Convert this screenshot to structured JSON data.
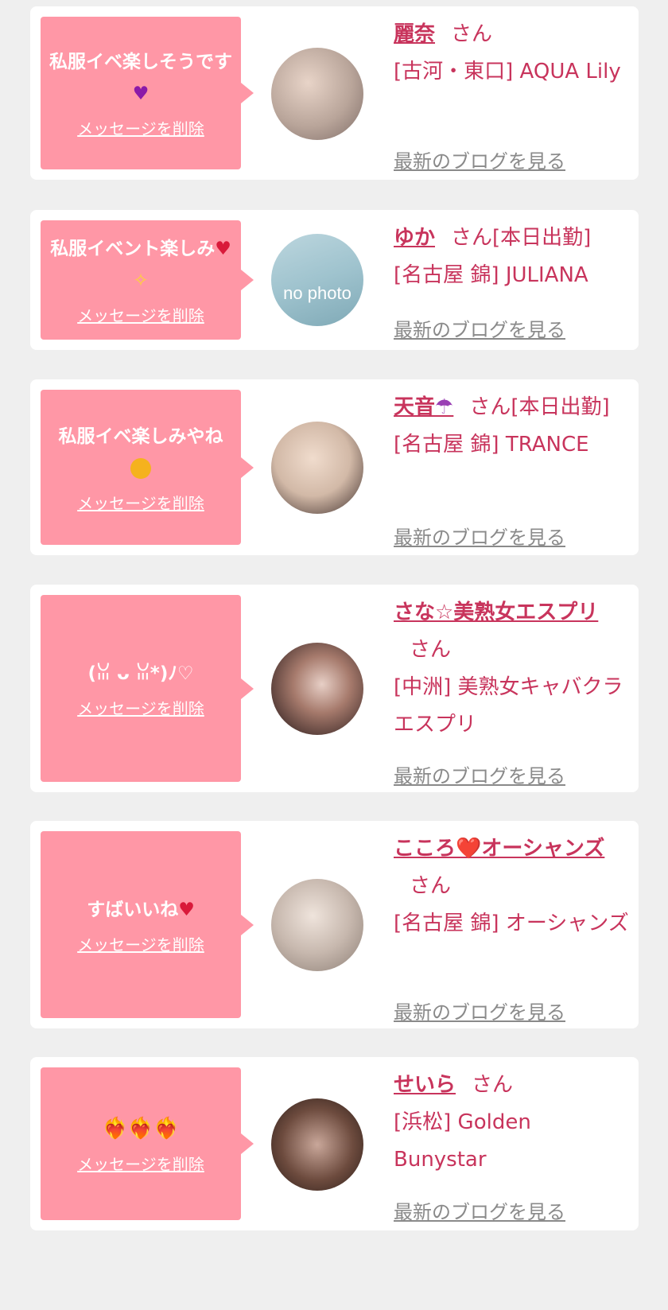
{
  "cards": [
    {
      "message": "私服イベ楽しそうです",
      "message_emoji": "purple-heart",
      "delete_label": "メッセージを削除",
      "name": "麗奈",
      "san": "さん",
      "status": "",
      "shop": "[古河・東口] AQUA Lily",
      "blog_label": "最新のブログを見る",
      "avatar_color": "#b9a59a"
    },
    {
      "message": "私服イベント楽しみ",
      "message_emoji": "heart-sparkle",
      "delete_label": "メッセージを削除",
      "name": "ゆか",
      "san": "さん",
      "status": "[本日出勤]",
      "shop": "[名古屋 錦] JULIANA",
      "blog_label": "最新のブログを見る",
      "avatar_label": "no photo",
      "avatar_color": "#9fc3ce"
    },
    {
      "message": "私服イベ楽しみやね",
      "message_emoji": "smile",
      "delete_label": "メッセージを削除",
      "name": "天音",
      "name_emoji": "jellyfish",
      "san": "さん",
      "status": "[本日出勤]",
      "shop": "[名古屋 錦] TRANCE",
      "blog_label": "最新のブログを見る",
      "avatar_color": "#d2b9a7"
    },
    {
      "message": "(ꈍ ᴗ ꈍ*)ﾉ♡",
      "message_emoji": "",
      "delete_label": "メッセージを削除",
      "name": "さな☆美熟女エスプリ",
      "san": "さん",
      "status": "",
      "shop": "[中洲] 美熟女キャバクラ エスプリ",
      "blog_label": "最新のブログを見る",
      "avatar_color": "#5a3a35"
    },
    {
      "message": "すばいいね",
      "message_emoji": "heart",
      "delete_label": "メッセージを削除",
      "name": "こころ❤️オーシャンズ",
      "san": "さん",
      "status": "",
      "shop": "[名古屋 錦] オーシャンズ",
      "blog_label": "最新のブログを見る",
      "avatar_color": "#c7b8ae"
    },
    {
      "message": "❤️‍🔥❤️‍🔥❤️‍🔥",
      "message_emoji": "fire-hearts",
      "delete_label": "メッセージを削除",
      "name": "せいら",
      "san": "さん",
      "status": "",
      "shop": "[浜松] Golden Bunystar",
      "blog_label": "最新のブログを見る",
      "avatar_color": "#6d4b3e"
    }
  ],
  "colors": {
    "accent": "#c8345c",
    "bubble": "#ff97a6",
    "blog_link": "#8a8a8a",
    "background": "#efefef"
  }
}
